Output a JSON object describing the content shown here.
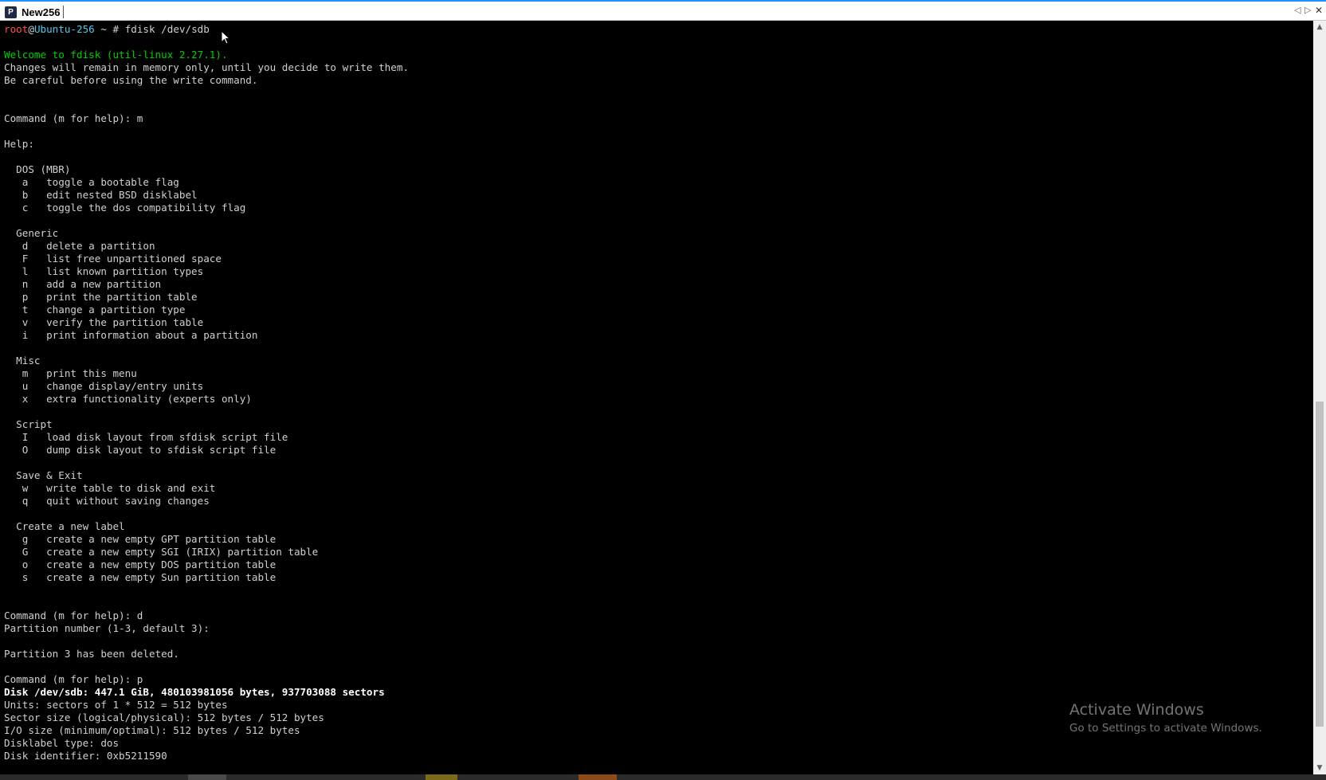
{
  "window": {
    "tab_title": "New256",
    "tab_icon_glyph": "P",
    "controls": [
      "◁",
      "▷",
      "✕"
    ]
  },
  "colors": {
    "prompt_user": "#ff5050",
    "prompt_host": "#55c8e8",
    "welcome": "#00d000",
    "text": "#d0d0d0",
    "bold_text": "#ffffff",
    "tab_accent": "#1e90ff"
  },
  "prompt": {
    "user": "root",
    "at": "@",
    "host": "Ubuntu-256",
    "rest": " ~ # ",
    "command": "fdisk /dev/sdb"
  },
  "terminal_lines": [
    {
      "text": "",
      "style": "normal"
    },
    {
      "text": "Welcome to fdisk (util-linux 2.27.1).",
      "style": "welcome"
    },
    {
      "text": "Changes will remain in memory only, until you decide to write them.",
      "style": "normal"
    },
    {
      "text": "Be careful before using the write command.",
      "style": "normal"
    },
    {
      "text": "",
      "style": "normal"
    },
    {
      "text": "",
      "style": "normal"
    },
    {
      "text": "Command (m for help): m",
      "style": "normal"
    },
    {
      "text": "",
      "style": "normal"
    },
    {
      "text": "Help:",
      "style": "normal"
    },
    {
      "text": "",
      "style": "normal"
    },
    {
      "text": "  DOS (MBR)",
      "style": "normal"
    },
    {
      "text": "   a   toggle a bootable flag",
      "style": "normal"
    },
    {
      "text": "   b   edit nested BSD disklabel",
      "style": "normal"
    },
    {
      "text": "   c   toggle the dos compatibility flag",
      "style": "normal"
    },
    {
      "text": "",
      "style": "normal"
    },
    {
      "text": "  Generic",
      "style": "normal"
    },
    {
      "text": "   d   delete a partition",
      "style": "normal"
    },
    {
      "text": "   F   list free unpartitioned space",
      "style": "normal"
    },
    {
      "text": "   l   list known partition types",
      "style": "normal"
    },
    {
      "text": "   n   add a new partition",
      "style": "normal"
    },
    {
      "text": "   p   print the partition table",
      "style": "normal"
    },
    {
      "text": "   t   change a partition type",
      "style": "normal"
    },
    {
      "text": "   v   verify the partition table",
      "style": "normal"
    },
    {
      "text": "   i   print information about a partition",
      "style": "normal"
    },
    {
      "text": "",
      "style": "normal"
    },
    {
      "text": "  Misc",
      "style": "normal"
    },
    {
      "text": "   m   print this menu",
      "style": "normal"
    },
    {
      "text": "   u   change display/entry units",
      "style": "normal"
    },
    {
      "text": "   x   extra functionality (experts only)",
      "style": "normal"
    },
    {
      "text": "",
      "style": "normal"
    },
    {
      "text": "  Script",
      "style": "normal"
    },
    {
      "text": "   I   load disk layout from sfdisk script file",
      "style": "normal"
    },
    {
      "text": "   O   dump disk layout to sfdisk script file",
      "style": "normal"
    },
    {
      "text": "",
      "style": "normal"
    },
    {
      "text": "  Save & Exit",
      "style": "normal"
    },
    {
      "text": "   w   write table to disk and exit",
      "style": "normal"
    },
    {
      "text": "   q   quit without saving changes",
      "style": "normal"
    },
    {
      "text": "",
      "style": "normal"
    },
    {
      "text": "  Create a new label",
      "style": "normal"
    },
    {
      "text": "   g   create a new empty GPT partition table",
      "style": "normal"
    },
    {
      "text": "   G   create a new empty SGI (IRIX) partition table",
      "style": "normal"
    },
    {
      "text": "   o   create a new empty DOS partition table",
      "style": "normal"
    },
    {
      "text": "   s   create a new empty Sun partition table",
      "style": "normal"
    },
    {
      "text": "",
      "style": "normal"
    },
    {
      "text": "",
      "style": "normal"
    },
    {
      "text": "Command (m for help): d",
      "style": "normal"
    },
    {
      "text": "Partition number (1-3, default 3):",
      "style": "normal"
    },
    {
      "text": "",
      "style": "normal"
    },
    {
      "text": "Partition 3 has been deleted.",
      "style": "normal"
    },
    {
      "text": "",
      "style": "normal"
    },
    {
      "text": "Command (m for help): p",
      "style": "normal"
    },
    {
      "text": "Disk /dev/sdb: 447.1 GiB, 480103981056 bytes, 937703088 sectors",
      "style": "bold"
    },
    {
      "text": "Units: sectors of 1 * 512 = 512 bytes",
      "style": "normal"
    },
    {
      "text": "Sector size (logical/physical): 512 bytes / 512 bytes",
      "style": "normal"
    },
    {
      "text": "I/O size (minimum/optimal): 512 bytes / 512 bytes",
      "style": "normal"
    },
    {
      "text": "Disklabel type: dos",
      "style": "normal"
    },
    {
      "text": "Disk identifier: 0xb5211590",
      "style": "normal"
    }
  ],
  "scrollbar": {
    "up_arrow": "▲",
    "down_arrow": "▼"
  },
  "watermark": {
    "title": "Activate Windows",
    "subtitle": "Go to Settings to activate Windows."
  },
  "taskbar": {
    "colors": [
      "#4a4a4a",
      "#7a6a1a",
      "#8a4a1a"
    ]
  }
}
